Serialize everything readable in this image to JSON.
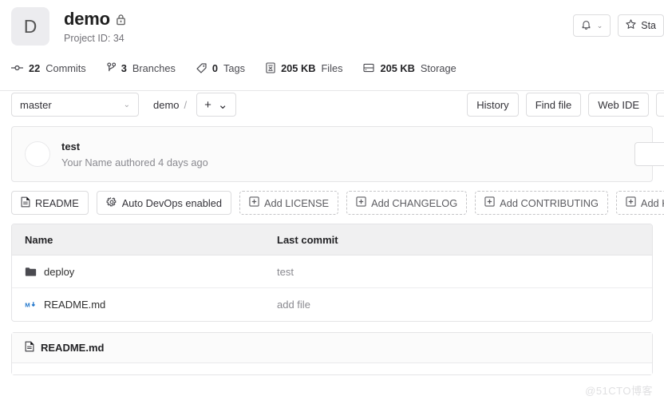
{
  "project": {
    "avatar_letter": "D",
    "name": "demo",
    "visibility_icon": "lock-icon",
    "project_id_label": "Project ID: 34"
  },
  "header_actions": {
    "notifications_icon": "bell-icon",
    "notifications_caret": "⌄",
    "star_icon": "star-icon",
    "star_label": "Sta"
  },
  "stats": [
    {
      "icon": "commit-icon",
      "value": "22",
      "label": "Commits"
    },
    {
      "icon": "branch-icon",
      "value": "3",
      "label": "Branches"
    },
    {
      "icon": "tag-icon",
      "value": "0",
      "label": "Tags"
    },
    {
      "icon": "file-icon",
      "value": "205 KB",
      "label": "Files"
    },
    {
      "icon": "storage-icon",
      "value": "205 KB",
      "label": "Storage"
    }
  ],
  "toolbar": {
    "branch": "master",
    "branch_caret": "⌄",
    "breadcrumb_root": "demo",
    "breadcrumb_sep": "/",
    "add_plus": "+",
    "add_caret": "⌄",
    "actions": [
      {
        "label": "History"
      },
      {
        "label": "Find file"
      },
      {
        "label": "Web IDE"
      }
    ]
  },
  "commit": {
    "title": "test",
    "meta": "Your Name authored 4 days ago"
  },
  "quick_actions": [
    {
      "label": "README",
      "icon": "file-doc-icon",
      "style": "solid"
    },
    {
      "label": "Auto DevOps enabled",
      "icon": "gear-icon",
      "style": "solid"
    },
    {
      "label": "Add LICENSE",
      "icon": "plus-box-icon",
      "style": "dashed"
    },
    {
      "label": "Add CHANGELOG",
      "icon": "plus-box-icon",
      "style": "dashed"
    },
    {
      "label": "Add CONTRIBUTING",
      "icon": "plus-box-icon",
      "style": "dashed"
    },
    {
      "label": "Add Kub",
      "icon": "plus-box-icon",
      "style": "dashed"
    }
  ],
  "file_table": {
    "columns": {
      "name": "Name",
      "last_commit": "Last commit"
    },
    "rows": [
      {
        "icon": "folder-icon",
        "name": "deploy",
        "last_commit": "test"
      },
      {
        "icon": "markdown-icon",
        "name": "README.md",
        "last_commit": "add file"
      }
    ]
  },
  "readme": {
    "icon": "file-doc-icon",
    "title": "README.md"
  },
  "watermark": "@51CTO博客",
  "colors": {
    "accent_blue": "#1f75cb",
    "border": "#e4e4e6",
    "header_bg": "#f0f0f1",
    "muted_text": "#8a8a90"
  }
}
